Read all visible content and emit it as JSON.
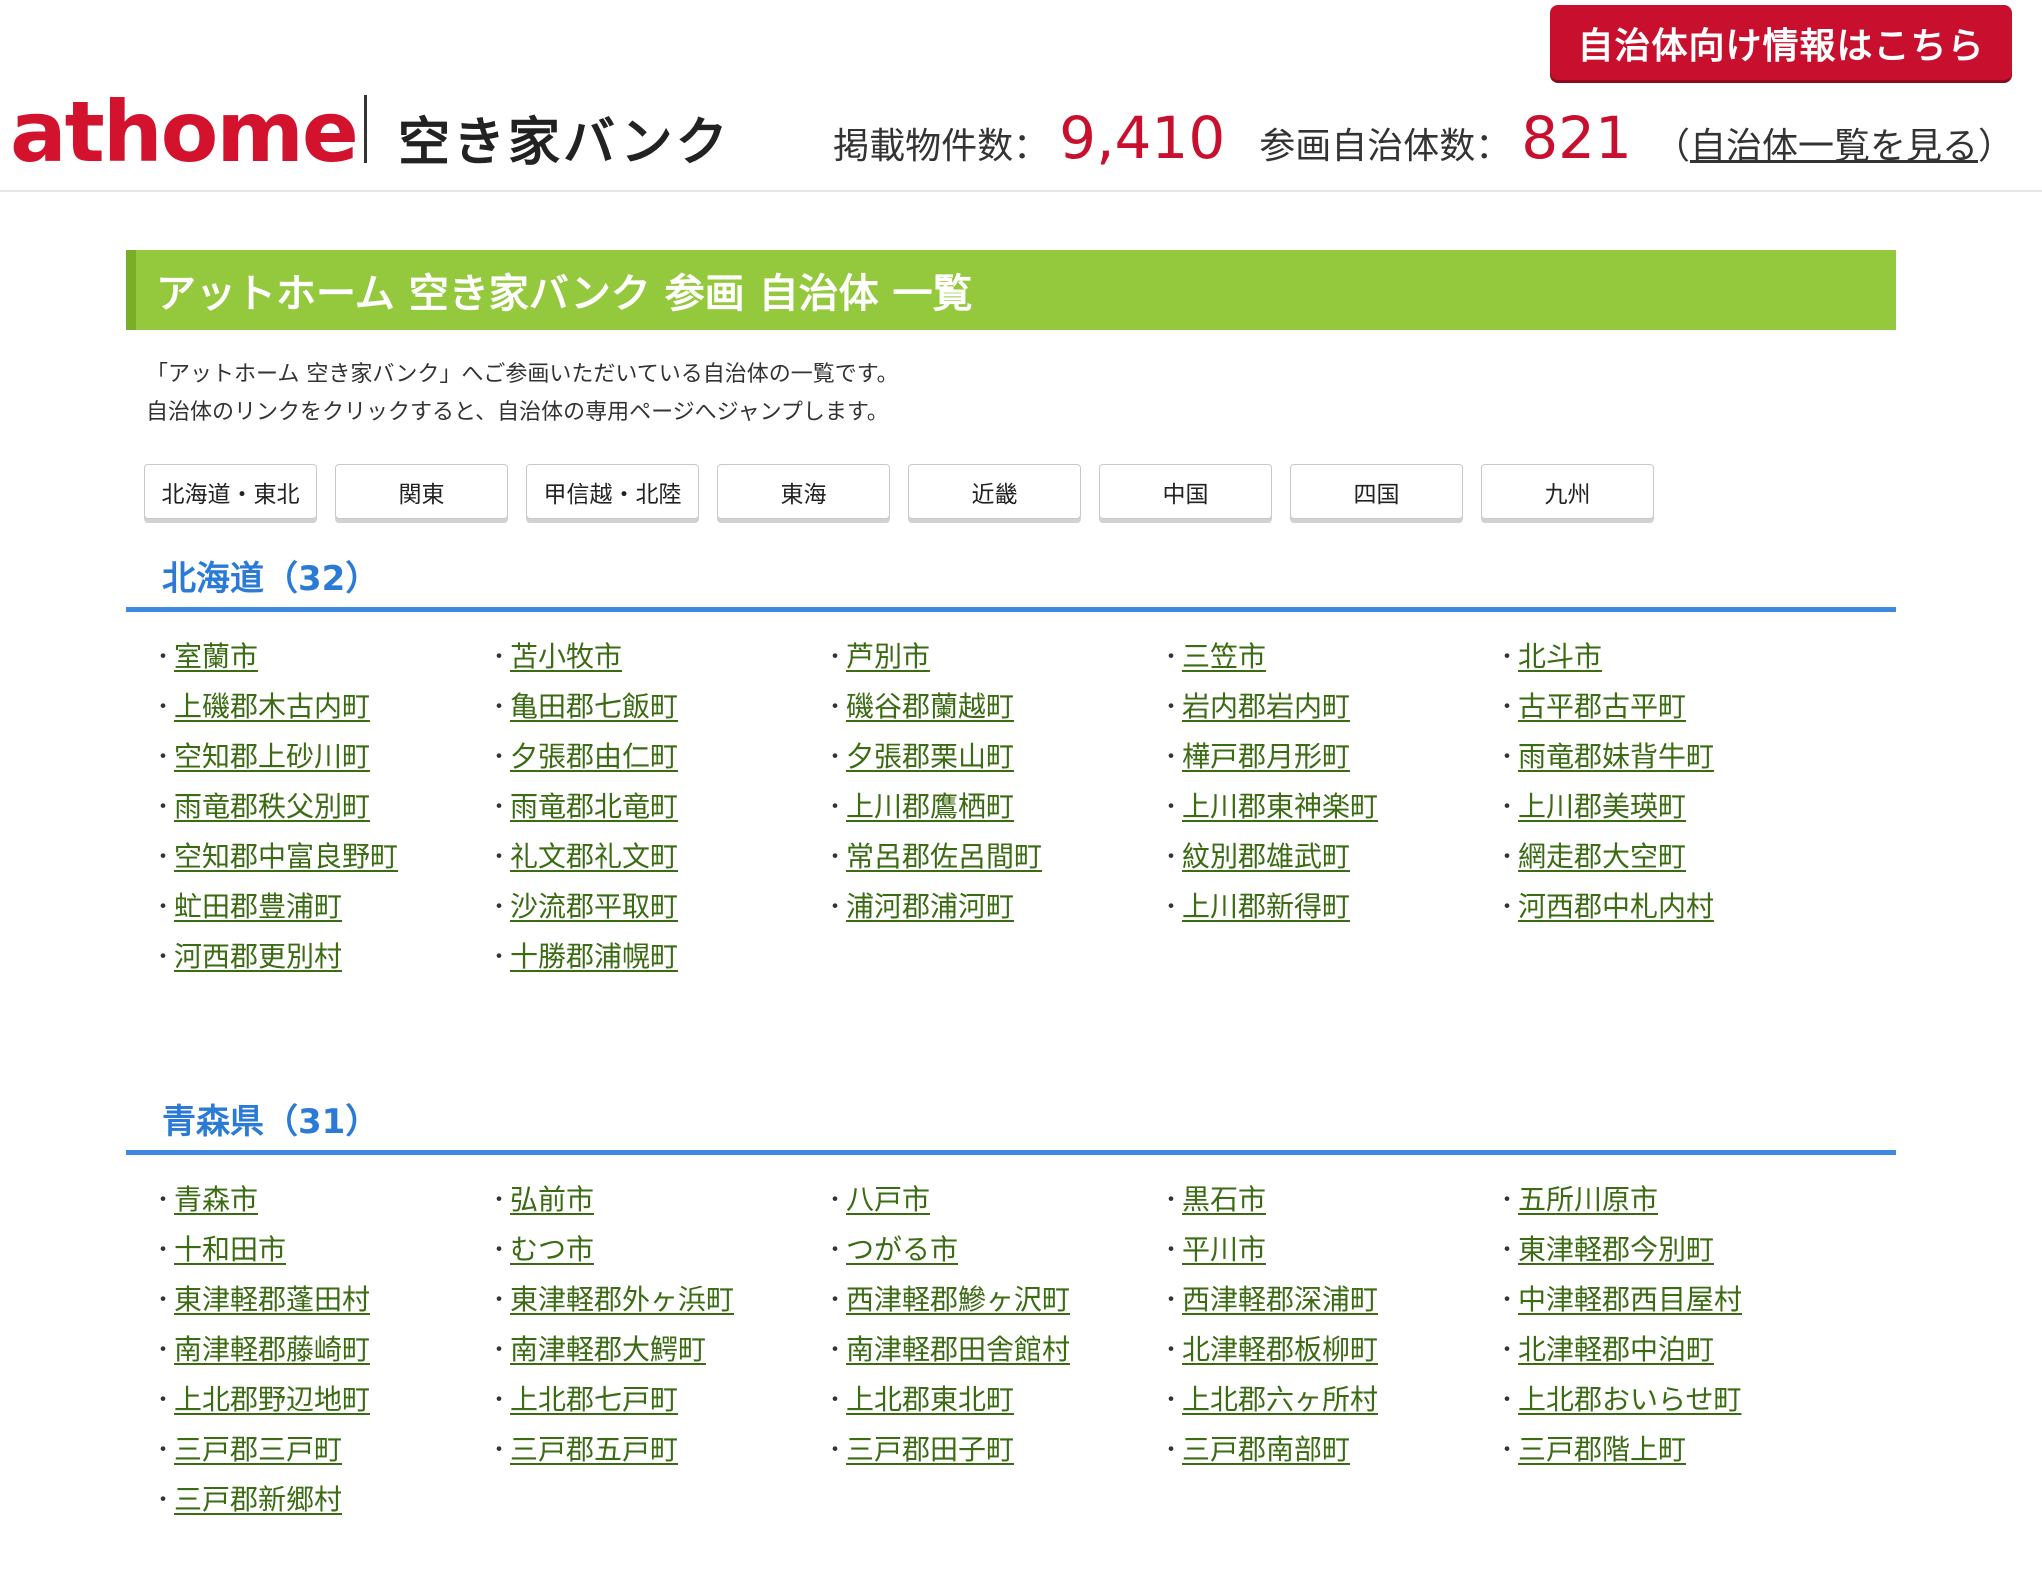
{
  "header": {
    "muni_info_button": "自治体向け情報はこちら",
    "logo_text": "athome",
    "service_name": "空き家バンク",
    "listing_count_label": "掲載物件数：",
    "listing_count": "9,410",
    "muni_count_label": "参画自治体数：",
    "muni_count": "821",
    "muni_list_open": "（",
    "muni_list_link": "自治体一覧を見る",
    "muni_list_close": "）"
  },
  "banner": {
    "title": "アットホーム 空き家バンク 参画 自治体 一覧"
  },
  "intro": {
    "line1": "「アットホーム 空き家バンク」へご参画いただいている自治体の一覧です。",
    "line2": "自治体のリンクをクリックすると、自治体の専用ページへジャンプします。"
  },
  "regions": [
    "北海道・東北",
    "関東",
    "甲信越・北陸",
    "東海",
    "近畿",
    "中国",
    "四国",
    "九州"
  ],
  "prefectures": [
    {
      "heading": "北海道（32）",
      "municipalities": [
        "室蘭市",
        "苫小牧市",
        "芦別市",
        "三笠市",
        "北斗市",
        "上磯郡木古内町",
        "亀田郡七飯町",
        "磯谷郡蘭越町",
        "岩内郡岩内町",
        "古平郡古平町",
        "空知郡上砂川町",
        "夕張郡由仁町",
        "夕張郡栗山町",
        "樺戸郡月形町",
        "雨竜郡妹背牛町",
        "雨竜郡秩父別町",
        "雨竜郡北竜町",
        "上川郡鷹栖町",
        "上川郡東神楽町",
        "上川郡美瑛町",
        "空知郡中富良野町",
        "礼文郡礼文町",
        "常呂郡佐呂間町",
        "紋別郡雄武町",
        "網走郡大空町",
        "虻田郡豊浦町",
        "沙流郡平取町",
        "浦河郡浦河町",
        "上川郡新得町",
        "河西郡中札内村",
        "河西郡更別村",
        "十勝郡浦幌町"
      ]
    },
    {
      "heading": "青森県（31）",
      "municipalities": [
        "青森市",
        "弘前市",
        "八戸市",
        "黒石市",
        "五所川原市",
        "十和田市",
        "むつ市",
        "つがる市",
        "平川市",
        "東津軽郡今別町",
        "東津軽郡蓬田村",
        "東津軽郡外ヶ浜町",
        "西津軽郡鰺ヶ沢町",
        "西津軽郡深浦町",
        "中津軽郡西目屋村",
        "南津軽郡藤崎町",
        "南津軽郡大鰐町",
        "南津軽郡田舎館村",
        "北津軽郡板柳町",
        "北津軽郡中泊町",
        "上北郡野辺地町",
        "上北郡七戸町",
        "上北郡東北町",
        "上北郡六ヶ所村",
        "上北郡おいらせ町",
        "三戸郡三戸町",
        "三戸郡五戸町",
        "三戸郡田子町",
        "三戸郡南部町",
        "三戸郡階上町",
        "三戸郡新郷村"
      ]
    }
  ]
}
